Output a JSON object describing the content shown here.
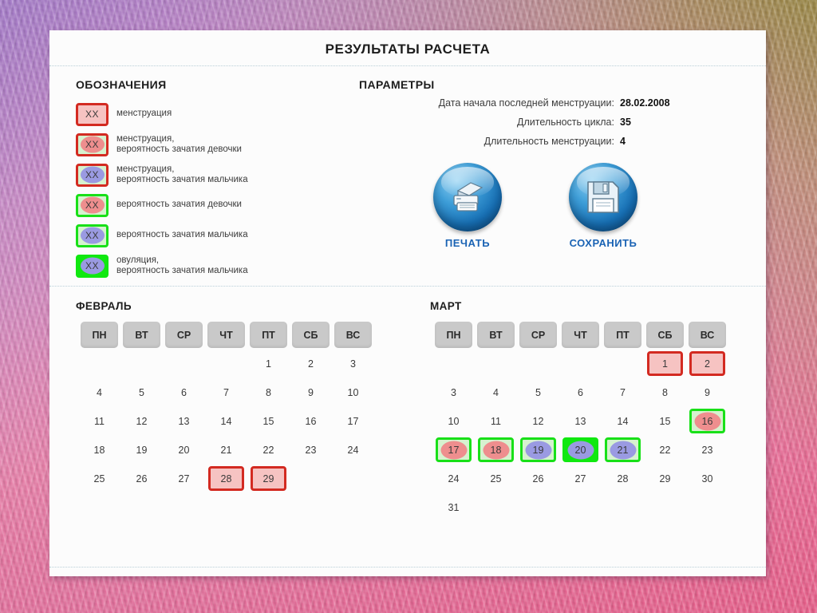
{
  "page": {
    "title": "РЕЗУЛЬТАТЫ РАСЧЕТА"
  },
  "legend": {
    "heading": "ОБОЗНАЧЕНИЯ",
    "swatch_text": "XX",
    "items": [
      {
        "line1": "менструация",
        "line2": "",
        "fill": "#f6c3c2",
        "border": "#d32a21",
        "ellipse": ""
      },
      {
        "line1": "менструация,",
        "line2": "вероятность зачатия девочки",
        "fill": "#d6f2cf",
        "border": "#d32a21",
        "ellipse": "#ee8e8e"
      },
      {
        "line1": "менструация,",
        "line2": "вероятность зачатия мальчика",
        "fill": "#d6f2cf",
        "border": "#d32a21",
        "ellipse": "#9a9ae2"
      },
      {
        "line1": "вероятность зачатия девочки",
        "line2": "",
        "fill": "#d6f2cf",
        "border": "#18e018",
        "ellipse": "#ee8e8e"
      },
      {
        "line1": "вероятность зачатия мальчика",
        "line2": "",
        "fill": "#d6f2cf",
        "border": "#18e018",
        "ellipse": "#9a9ae2"
      },
      {
        "line1": "овуляция,",
        "line2": "вероятность зачатия мальчика",
        "fill": "#10e810",
        "border": "#10e810",
        "ellipse": "#9a9ae2"
      }
    ]
  },
  "parameters": {
    "heading": "ПАРАМЕТРЫ",
    "rows": [
      {
        "label": "Дата начала последней менструации:",
        "value": "28.02.2008"
      },
      {
        "label": "Длительность цикла:",
        "value": "35"
      },
      {
        "label": "Длительность менструации:",
        "value": "4"
      }
    ]
  },
  "actions": [
    {
      "label": "ПЕЧАТЬ",
      "icon": "printer-icon"
    },
    {
      "label": "СОХРАНИТЬ",
      "icon": "floppy-disk-icon"
    }
  ],
  "colors": {
    "menstruation_fill": "#f6c3c2",
    "menstruation_border": "#d32a21",
    "fertile_fill": "#d6f2cf",
    "fertile_border": "#18e018",
    "ovulation_fill": "#10e810",
    "girl_ellipse": "#ee8e8e",
    "boy_ellipse": "#9a9ae2",
    "weekday_header": "#c9c9c9",
    "accent_link": "#1a63b4"
  },
  "calendars": [
    {
      "name": "ФЕВРАЛЬ",
      "weekdays": [
        "ПН",
        "ВТ",
        "СР",
        "ЧТ",
        "ПТ",
        "СБ",
        "ВС"
      ],
      "weeks": [
        [
          null,
          null,
          null,
          null,
          {
            "d": "1"
          },
          {
            "d": "2"
          },
          {
            "d": "3"
          }
        ],
        [
          {
            "d": "4"
          },
          {
            "d": "5"
          },
          {
            "d": "6"
          },
          {
            "d": "7"
          },
          {
            "d": "8"
          },
          {
            "d": "9"
          },
          {
            "d": "10"
          }
        ],
        [
          {
            "d": "11"
          },
          {
            "d": "12"
          },
          {
            "d": "13"
          },
          {
            "d": "14"
          },
          {
            "d": "15"
          },
          {
            "d": "16"
          },
          {
            "d": "17"
          }
        ],
        [
          {
            "d": "18"
          },
          {
            "d": "19"
          },
          {
            "d": "20"
          },
          {
            "d": "21"
          },
          {
            "d": "22"
          },
          {
            "d": "23"
          },
          {
            "d": "24"
          }
        ],
        [
          {
            "d": "25"
          },
          {
            "d": "26"
          },
          {
            "d": "27"
          },
          {
            "d": "28",
            "m": "menstruation"
          },
          {
            "d": "29",
            "m": "menstruation"
          },
          null,
          null
        ]
      ]
    },
    {
      "name": "МАРТ",
      "weekdays": [
        "ПН",
        "ВТ",
        "СР",
        "ЧТ",
        "ПТ",
        "СБ",
        "ВС"
      ],
      "weeks": [
        [
          null,
          null,
          null,
          null,
          null,
          {
            "d": "1",
            "m": "menstruation"
          },
          {
            "d": "2",
            "m": "menstruation"
          }
        ],
        [
          {
            "d": "3"
          },
          {
            "d": "4"
          },
          {
            "d": "5"
          },
          {
            "d": "6"
          },
          {
            "d": "7"
          },
          {
            "d": "8"
          },
          {
            "d": "9"
          }
        ],
        [
          {
            "d": "10"
          },
          {
            "d": "11"
          },
          {
            "d": "12"
          },
          {
            "d": "13"
          },
          {
            "d": "14"
          },
          {
            "d": "15"
          },
          {
            "d": "16",
            "m": "girl"
          }
        ],
        [
          {
            "d": "17",
            "m": "girl"
          },
          {
            "d": "18",
            "m": "girl"
          },
          {
            "d": "19",
            "m": "boy"
          },
          {
            "d": "20",
            "m": "ovulation"
          },
          {
            "d": "21",
            "m": "boy"
          },
          {
            "d": "22"
          },
          {
            "d": "23"
          }
        ],
        [
          {
            "d": "24"
          },
          {
            "d": "25"
          },
          {
            "d": "26"
          },
          {
            "d": "27"
          },
          {
            "d": "28"
          },
          {
            "d": "29"
          },
          {
            "d": "30"
          }
        ],
        [
          {
            "d": "31"
          },
          null,
          null,
          null,
          null,
          null,
          null
        ]
      ]
    }
  ]
}
